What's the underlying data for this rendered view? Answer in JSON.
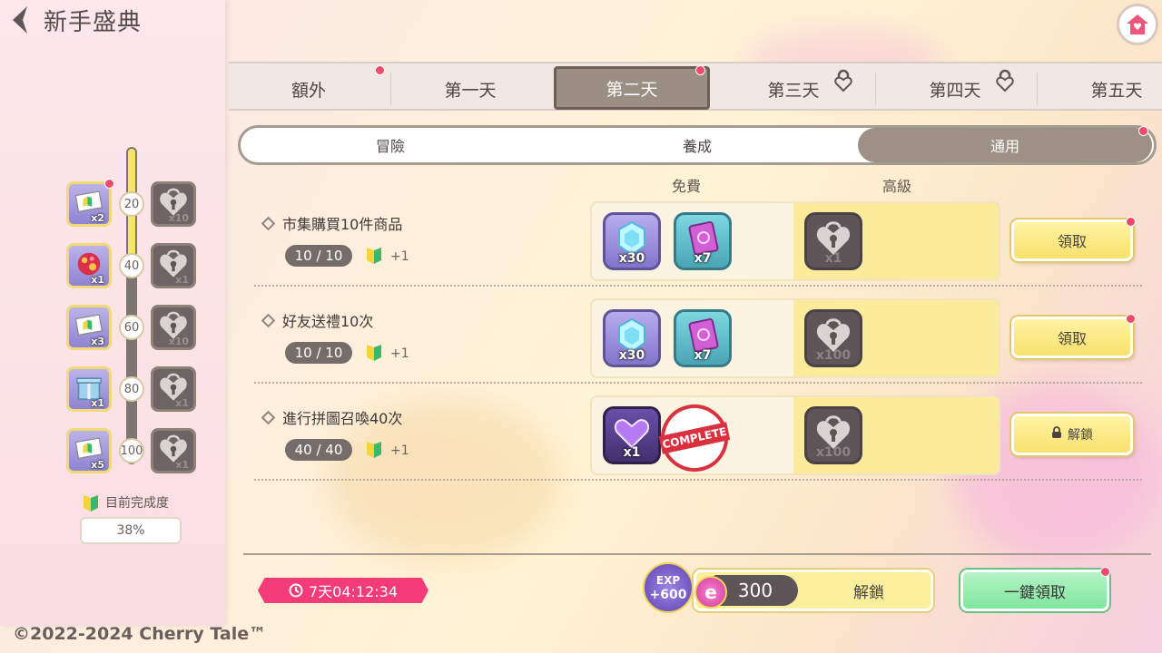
{
  "header": {
    "title": "新手盛典"
  },
  "day_tabs": [
    {
      "label": "額外",
      "dot": true,
      "locked": false,
      "selected": false
    },
    {
      "label": "第一天",
      "dot": false,
      "locked": false,
      "selected": false
    },
    {
      "label": "第二天",
      "dot": true,
      "locked": false,
      "selected": true
    },
    {
      "label": "第三天",
      "dot": false,
      "locked": true,
      "selected": false
    },
    {
      "label": "第四天",
      "dot": false,
      "locked": true,
      "selected": false
    },
    {
      "label": "第五天",
      "dot": false,
      "locked": false,
      "selected": false
    }
  ],
  "sub_tabs": [
    {
      "label": "冒險",
      "selected": false
    },
    {
      "label": "養成",
      "selected": false
    },
    {
      "label": "通用",
      "selected": true
    }
  ],
  "columns": {
    "free": "免費",
    "premium": "高級"
  },
  "tasks": [
    {
      "name": "市集購買10件商品",
      "progress": "10 / 10",
      "bonus": "+1",
      "free_rewards": [
        {
          "icon": "gem-icon",
          "count": "x30"
        },
        {
          "icon": "book-icon",
          "count": "x7"
        }
      ],
      "premium_rewards": [
        {
          "icon": "locked-chest-icon",
          "count": "x1"
        }
      ],
      "button": "領取",
      "button_dot": true,
      "complete": false
    },
    {
      "name": "好友送禮10次",
      "progress": "10 / 10",
      "bonus": "+1",
      "free_rewards": [
        {
          "icon": "gem-icon",
          "count": "x30"
        },
        {
          "icon": "book-icon",
          "count": "x7"
        }
      ],
      "premium_rewards": [
        {
          "icon": "locked-coin-bag-icon",
          "count": "x100"
        }
      ],
      "button": "領取",
      "button_dot": true,
      "complete": false
    },
    {
      "name": "進行拼圖召喚40次",
      "progress": "40 / 40",
      "bonus": "+1",
      "free_rewards": [
        {
          "icon": "heart-gift-icon",
          "count": "x1"
        }
      ],
      "premium_rewards": [
        {
          "icon": "locked-coin-bag-icon",
          "count": "x100"
        }
      ],
      "button": "解鎖",
      "button_dot": false,
      "complete": true,
      "complete_label": "COMPLETE"
    }
  ],
  "milestones": [
    {
      "value": "20",
      "free_count": "x2",
      "premium_count": "x10",
      "free_dot": true
    },
    {
      "value": "40",
      "free_count": "x1",
      "premium_count": "x1",
      "free_dot": false
    },
    {
      "value": "60",
      "free_count": "x3",
      "premium_count": "x10",
      "free_dot": false
    },
    {
      "value": "80",
      "free_count": "x1",
      "premium_count": "x1",
      "free_dot": false
    },
    {
      "value": "100",
      "free_count": "x5",
      "premium_count": "x1",
      "free_dot": false
    }
  ],
  "completion": {
    "label": "目前完成度",
    "value": "38%",
    "progress_fraction": 0.38
  },
  "timer": "7天04:12:34",
  "exp_badge": {
    "line1": "EXP",
    "line2": "+600"
  },
  "unlock": {
    "coin_symbol": "e",
    "cost": "300",
    "label": "解鎖"
  },
  "claim_all": "一鍵領取",
  "copyright": "©2022-2024 Cherry Tale™",
  "colors": {
    "accent_pink": "#f23b78",
    "claim_yellow": "#f8e16c",
    "claim_all_green": "#7fe69d",
    "tab_selected": "#9b8f84"
  }
}
